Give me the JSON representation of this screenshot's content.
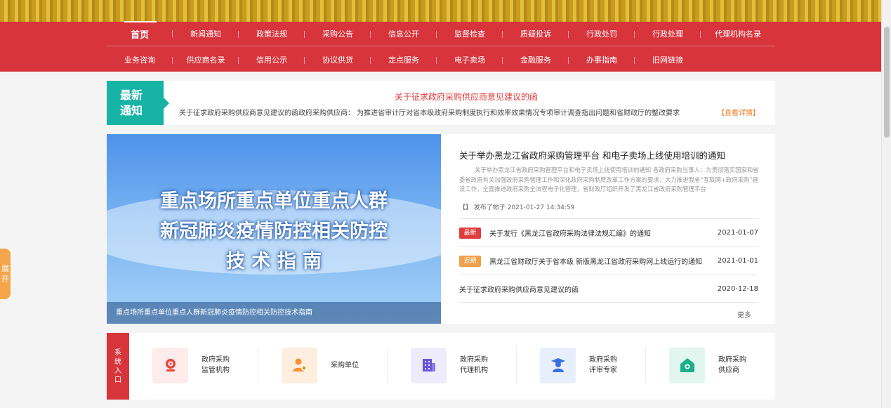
{
  "nav": {
    "row1": [
      "首页",
      "新闻通知",
      "政策法规",
      "采购公告",
      "信息公开",
      "监督检查",
      "质疑投诉",
      "行政处罚",
      "行政处理",
      "代理机构名录"
    ],
    "row2": [
      "业务咨询",
      "供应商名录",
      "信用公示",
      "协议供货",
      "定点服务",
      "电子卖场",
      "金融服务",
      "办事指南",
      "旧网链接"
    ]
  },
  "side_tab": {
    "line1": "展",
    "line2": "开"
  },
  "notice": {
    "label_line1": "最新",
    "label_line2": "通知",
    "title": "关于征求政府采购供应商意见建议的函",
    "text": "关于征求政府采购供应商意见建议的函政府采购供应商： 为推进省审计厅对省本级政府采购制度执行和效率效果情况专项审计调查指出问题和省财政厅的整改要求",
    "more": "【查看详情】"
  },
  "banner": {
    "line1": "重点场所重点单位重点人群",
    "line2": "新冠肺炎疫情防控相关防控",
    "line3": "技 术 指 南",
    "caption": "重点场所重点单位重点人群新冠肺炎疫情防控相关防控技术指南"
  },
  "headline": {
    "title": "关于举办黑龙江省政府采购管理平台 和电子卖场上线使用培训的通知",
    "desc": "关于举办黑龙江省政府采购管理平台和电子卖场上线使用培训的通知 各政府采购当事人：为贯彻落实国家和省委省政府有关加强政府采购管理工作和深化政府采购制度改革工作方案的要求，大力推进我省“互联网+政府采购”建设工作，全面推进政府采购全流程电子化管理，省财政厅组织开发了黑龙江省政府采购管理平台",
    "meta": "【】 发布了帖子   2021-01-27 14:34:59"
  },
  "news": [
    {
      "badge": "最新",
      "badge_color": "#e03c3c",
      "title": "关于发行《黑龙江省政府采购法律法规汇编》的通知",
      "date": "2021-01-07"
    },
    {
      "badge": "近期",
      "badge_color": "#f2a14b",
      "title": "黑龙江省财政厅关于省本级 新版黑龙江省政府采购网上线运行的通知",
      "date": "2021-01-01"
    },
    {
      "badge": "",
      "badge_color": "",
      "title": "关于征求政府采购供应商意见建议的函",
      "date": "2020-12-18"
    }
  ],
  "more_label": "更多",
  "system_entry": {
    "label": [
      "系",
      "统",
      "入",
      "口"
    ],
    "items": [
      {
        "line1": "政府采购",
        "line2": "监管机构",
        "icon": "camera-icon",
        "color": "#e8453c",
        "bg": "#fdeceb"
      },
      {
        "line1": "采购单位",
        "line2": "",
        "icon": "person-icon",
        "color": "#f5932f",
        "bg": "#fdeedf"
      },
      {
        "line1": "政府采购",
        "line2": "代理机构",
        "icon": "building-icon",
        "color": "#6a55d9",
        "bg": "#eeebfb"
      },
      {
        "line1": "政府采购",
        "line2": "评审专家",
        "icon": "expert-icon",
        "color": "#3a6fe0",
        "bg": "#e7effd"
      },
      {
        "line1": "政府采购",
        "line2": "供应商",
        "icon": "home-icon",
        "color": "#1bae8a",
        "bg": "#e2f6f0"
      }
    ]
  }
}
